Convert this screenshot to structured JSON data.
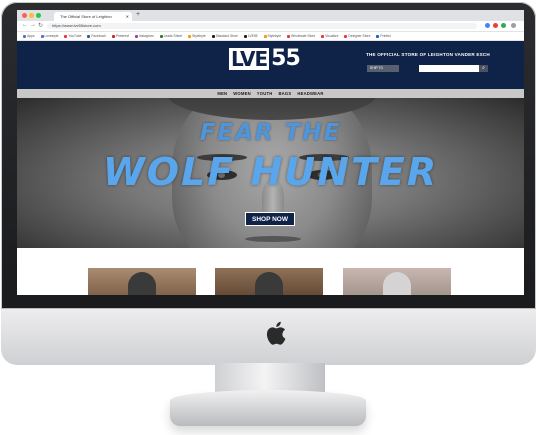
{
  "browser": {
    "tab_title": "The Official Store of Leighton",
    "url": "https://www.lve55store.com",
    "traffic_light_colors": [
      "#ff5f57",
      "#febc2e",
      "#28c840"
    ],
    "bookmarks": [
      "Apps",
      "Lovestyle",
      "YouTube",
      "Facebook",
      "Pinterest",
      "Instagram",
      "Leads Sheet",
      "Stylebyte",
      "Standard Store",
      "LVE55",
      "Stylebyte",
      "Wholesale Store",
      "Visualize",
      "Designer Store",
      "Printful"
    ]
  },
  "site": {
    "logo_boxed": "LVE",
    "logo_number": "55",
    "tagline": "THE OFFICIAL STORE OF LEIGHTON VANDER ESCH",
    "ship_to_label": "SHIP TO",
    "search_placeholder": "",
    "search_button_icon": "search-icon",
    "brand_navy": "#0f2248",
    "nav": [
      "MEN",
      "WOMEN",
      "YOUTH",
      "BAGS",
      "HEADWEAR"
    ],
    "hero": {
      "line1": "FEAR THE",
      "line2": "WOLF HUNTER",
      "cta": "SHOP NOW",
      "text_color": "#5aa6ec"
    }
  }
}
